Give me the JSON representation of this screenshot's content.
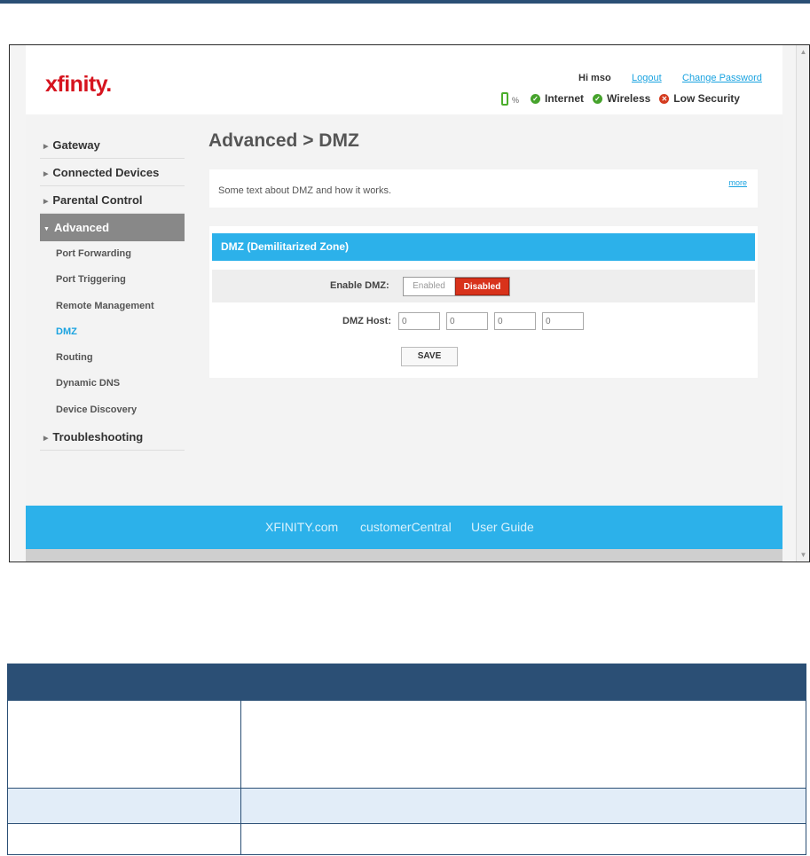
{
  "header": {
    "logo": "xfinity.",
    "greeting": "Hi mso",
    "logout": "Logout",
    "change_password": "Change Password",
    "battery_pct": "%",
    "status": [
      {
        "label": "Internet",
        "state": "ok"
      },
      {
        "label": "Wireless",
        "state": "ok"
      },
      {
        "label": "Low Security",
        "state": "warn"
      }
    ]
  },
  "sidebar": {
    "items": [
      {
        "label": "Gateway"
      },
      {
        "label": "Connected Devices"
      },
      {
        "label": "Parental Control"
      },
      {
        "label": "Advanced"
      },
      {
        "label": "Troubleshooting"
      }
    ],
    "advanced_sub": [
      {
        "label": "Port Forwarding"
      },
      {
        "label": "Port Triggering"
      },
      {
        "label": "Remote Management"
      },
      {
        "label": "DMZ"
      },
      {
        "label": "Routing"
      },
      {
        "label": "Dynamic DNS"
      },
      {
        "label": "Device Discovery"
      }
    ]
  },
  "main": {
    "title": "Advanced > DMZ",
    "info_text": "Some text about DMZ and how it works.",
    "more": "more",
    "panel_title": "DMZ (Demilitarized Zone)",
    "enable_label": "Enable DMZ:",
    "enabled_option": "Enabled",
    "disabled_option": "Disabled",
    "host_label": "DMZ Host:",
    "host_octets": [
      "0",
      "0",
      "0",
      "0"
    ],
    "save": "SAVE"
  },
  "footer": {
    "links": [
      "XFINITY.com",
      "customerCentral",
      "User Guide"
    ]
  },
  "colors": {
    "brand_red": "#d6141f",
    "accent_blue": "#2cb1ea",
    "table_header": "#2b4f75",
    "disabled_red": "#d8321b"
  }
}
